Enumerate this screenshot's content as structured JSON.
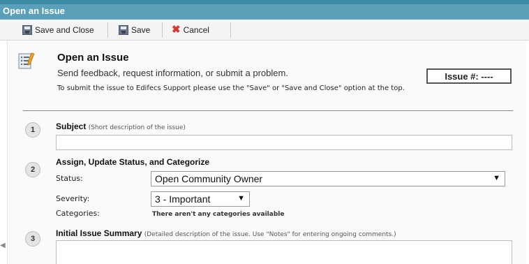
{
  "window": {
    "title": "Open an Issue"
  },
  "toolbar": {
    "save_close": "Save and Close",
    "save": "Save",
    "cancel": "Cancel"
  },
  "header": {
    "icon": "list-pencil-icon",
    "title": "Open an Issue",
    "subtitle": "Send feedback, request information, or submit a problem.",
    "note": "To submit the issue to Edifecs Support please use the \"Save\" or \"Save and Close\" option at the top.",
    "issue_number": "Issue #: ----"
  },
  "sections": [
    {
      "num": "1",
      "title": "Subject",
      "hint": "(Short description of the issue)",
      "value": ""
    },
    {
      "num": "2",
      "title": "Assign, Update Status, and Categorize",
      "status_label": "Status:",
      "status_value": "Open Community Owner",
      "severity_label": "Severity:",
      "severity_value": "3 - Important",
      "categories_label": "Categories:",
      "categories_value": "There aren't any categories available"
    },
    {
      "num": "3",
      "title": "Initial Issue Summary",
      "hint": "(Detailed description of the issue. Use \"Notes\" for entering ongoing comments.)",
      "value": ""
    }
  ],
  "colors": {
    "titlebar": "#5aa0b8",
    "titlebar_top": "#3d8aa3",
    "cancel_icon": "#d23a2e"
  }
}
